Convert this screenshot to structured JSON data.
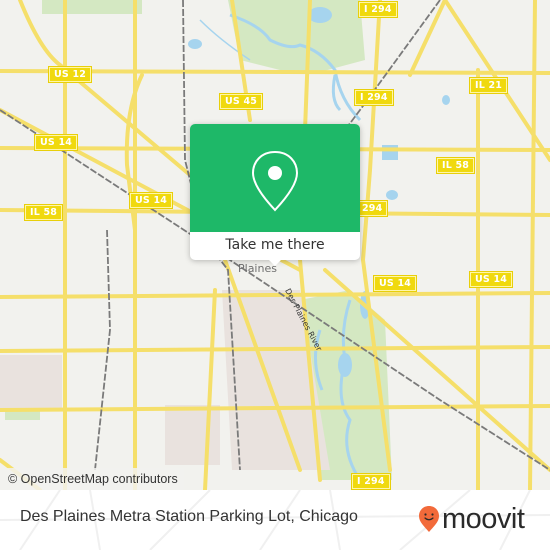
{
  "map": {
    "place_label": "Plaines",
    "river_label": "Des Plaines River",
    "shields": [
      {
        "id": "us12",
        "label": "US 12"
      },
      {
        "id": "us45",
        "label": "US 45"
      },
      {
        "id": "i294-top",
        "label": "I 294"
      },
      {
        "id": "i294-mid",
        "label": "I 294"
      },
      {
        "id": "i294-low",
        "label": "294"
      },
      {
        "id": "il21",
        "label": "IL 21"
      },
      {
        "id": "us14-left",
        "label": "US 14"
      },
      {
        "id": "us14-center",
        "label": "US 14"
      },
      {
        "id": "il58-left",
        "label": "IL 58"
      },
      {
        "id": "il58-right",
        "label": "IL 58"
      },
      {
        "id": "us14-right1",
        "label": "US 14"
      },
      {
        "id": "us14-right2",
        "label": "US 14"
      },
      {
        "id": "i294-bottom",
        "label": "I 294"
      }
    ],
    "attribution": "© OpenStreetMap contributors",
    "colors": {
      "background": "#f2f2ee",
      "road": "#f5df6a",
      "park": "#d4e8c2",
      "water": "#a6d4ee",
      "rail": "#7a7a7a",
      "residential": "#e9e2de"
    }
  },
  "popup": {
    "icon": "map-pin-icon",
    "button_label": "Take me there",
    "color": "#1eb868"
  },
  "footer": {
    "title": "Des Plaines Metra Station Parking Lot, Chicago",
    "brand": "moovit",
    "brand_color": "#f26a3a"
  }
}
